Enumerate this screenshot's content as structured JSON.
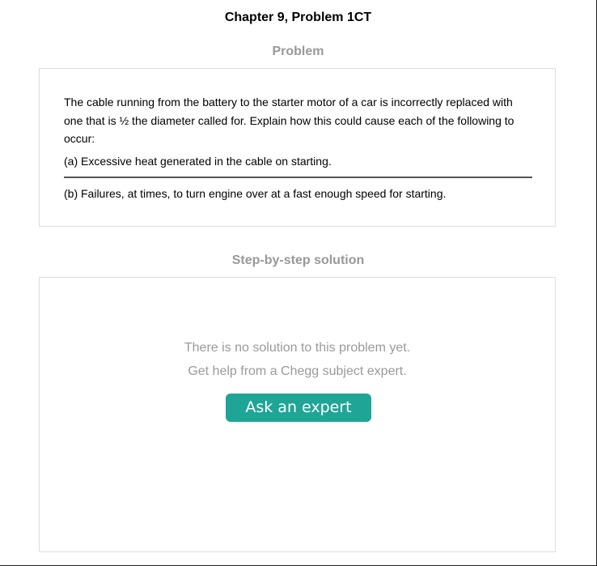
{
  "header": {
    "title": "Chapter 9, Problem 1CT"
  },
  "problem": {
    "heading": "Problem",
    "statement": "The cable running from the battery to the starter motor of a car is incorrectly replaced with one that is ½ the diameter called for. Explain how this could cause each of the following to occur:",
    "part_a": "(a) Excessive heat generated in the cable on starting.",
    "part_b": "(b) Failures, at times, to turn engine over at a fast enough speed for starting."
  },
  "solution": {
    "heading": "Step-by-step solution",
    "empty_line_1": "There is no solution to this problem yet.",
    "empty_line_2": "Get help from a Chegg subject expert.",
    "button_label": "Ask an expert",
    "button_color": "#1fa596"
  }
}
